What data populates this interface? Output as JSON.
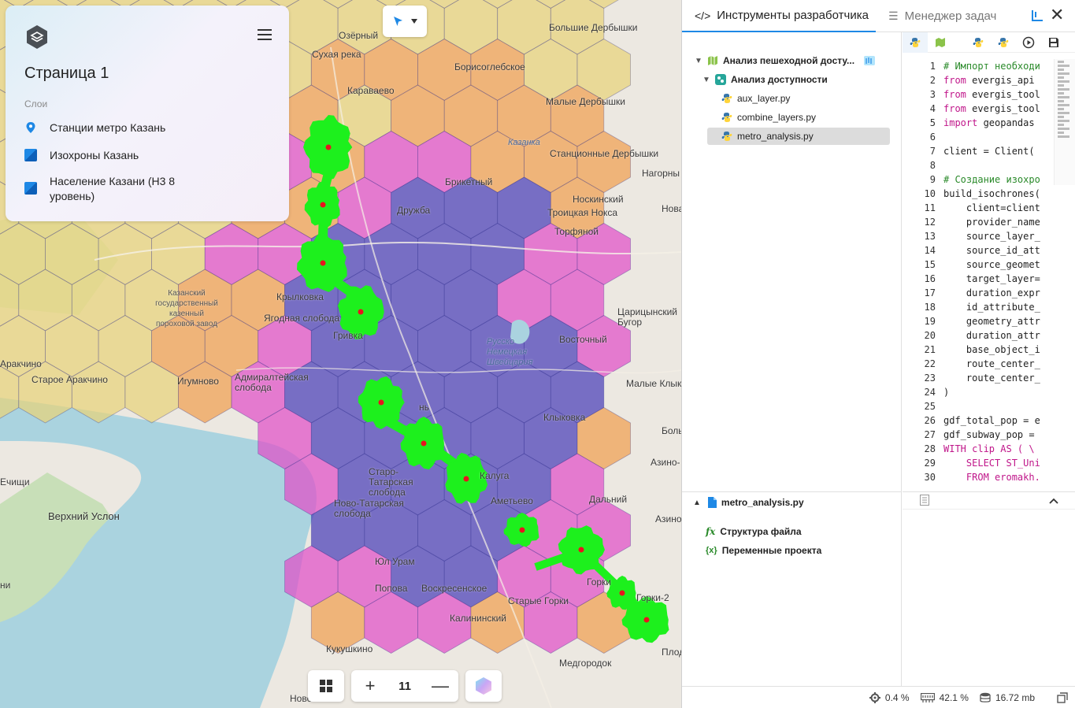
{
  "map": {
    "labels": [
      {
        "text": "Озёрный",
        "kind": "normal"
      },
      {
        "text": "Сухая река",
        "kind": "normal"
      },
      {
        "text": "Борисоглебское",
        "kind": "normal"
      },
      {
        "text": "Большие Дербышки",
        "kind": "normal"
      },
      {
        "text": "Караваево",
        "kind": "normal"
      },
      {
        "text": "Малые Дербышки",
        "kind": "normal"
      },
      {
        "text": "Казанка",
        "kind": "italic"
      },
      {
        "text": "Станционные Дербышки",
        "kind": "normal"
      },
      {
        "text": "Брикетный",
        "kind": "normal"
      },
      {
        "text": "Нагорны",
        "kind": "normal"
      },
      {
        "text": "Дружба",
        "kind": "normal"
      },
      {
        "text": "Носкинский",
        "kind": "normal"
      },
      {
        "text": "Троицкая Нокса",
        "kind": "normal"
      },
      {
        "text": "Нова",
        "kind": "normal"
      },
      {
        "text": "Торфяной",
        "kind": "normal"
      },
      {
        "text": "Казанский государственный казенный пороховой завод",
        "kind": "small"
      },
      {
        "text": "Крылковка",
        "kind": "normal"
      },
      {
        "text": "Ягодная слобода",
        "kind": "normal"
      },
      {
        "text": "Царицынский Бугор",
        "kind": "normal"
      },
      {
        "text": "Гривка",
        "kind": "normal"
      },
      {
        "text": "Русско Немецкая Швейцария",
        "kind": "italic"
      },
      {
        "text": "Восточный",
        "kind": "normal"
      },
      {
        "text": "Аракчино",
        "kind": "normal"
      },
      {
        "text": "Старое Аракчино",
        "kind": "normal"
      },
      {
        "text": "Иrумново",
        "kind": "normal"
      },
      {
        "text": "Адмиралтейская слобода",
        "kind": "normal"
      },
      {
        "text": "Малые Клык",
        "kind": "normal"
      },
      {
        "text": "Клыковка",
        "kind": "normal"
      },
      {
        "text": "Боль",
        "kind": "normal"
      },
      {
        "text": "Азино-",
        "kind": "normal"
      },
      {
        "text": "Старо-Татарская слобода",
        "kind": "normal"
      },
      {
        "text": "Калуга",
        "kind": "normal"
      },
      {
        "text": "Ечищи",
        "kind": "normal"
      },
      {
        "text": "Верхний Услон",
        "kind": "big"
      },
      {
        "text": "Ново-Татарская слобода",
        "kind": "normal"
      },
      {
        "text": "Аметьево",
        "kind": "normal"
      },
      {
        "text": "Дальний",
        "kind": "normal"
      },
      {
        "text": "Азино",
        "kind": "normal"
      },
      {
        "text": "Юл Урам",
        "kind": "normal"
      },
      {
        "text": "Горки",
        "kind": "normal"
      },
      {
        "text": "Попова",
        "kind": "normal"
      },
      {
        "text": "Воскресенское",
        "kind": "normal"
      },
      {
        "text": "Старые Горки",
        "kind": "normal"
      },
      {
        "text": "Горки-2",
        "kind": "normal"
      },
      {
        "text": "Калининский",
        "kind": "normal"
      },
      {
        "text": "Кукушкино",
        "kind": "normal"
      },
      {
        "text": "Медгородок",
        "kind": "normal"
      },
      {
        "text": "Плод",
        "kind": "normal"
      },
      {
        "text": "Ново",
        "kind": "normal"
      },
      {
        "text": "ни",
        "kind": "normal"
      },
      {
        "text": "нь",
        "kind": "normal"
      }
    ],
    "colors": {
      "water": "#aad3df",
      "hex_blue": "#4a3fb8",
      "hex_magenta": "#e04fc8",
      "hex_orange": "#f0a050",
      "hex_yellow": "#e8d27a",
      "isochrone": "#1df01d",
      "station": "#e8141e"
    }
  },
  "layers_panel": {
    "page_title": "Страница 1",
    "heading": "Слои",
    "layers": [
      {
        "label": "Станции метро Казань",
        "icon": "map-pin-icon"
      },
      {
        "label": "Изохроны Казань",
        "icon": "polygon-layer-icon"
      },
      {
        "label": "Население Казани (Н3 8 уровень)",
        "icon": "polygon-layer-icon"
      }
    ]
  },
  "zoom": {
    "value": "11",
    "plus": "+",
    "minus": "—"
  },
  "devtools": {
    "tabs": [
      {
        "label": "Инструменты разработчика",
        "icon": "code-icon",
        "active": true
      },
      {
        "label": "Менеджер задач",
        "icon": "list-icon",
        "active": false
      }
    ],
    "tree": [
      {
        "label": "Анализ пешеходной досту...",
        "level": 0,
        "icon": "map-icon",
        "bold": true
      },
      {
        "label": "Анализ доступности",
        "level": 1,
        "icon": "notebook-icon",
        "bold": true
      },
      {
        "label": "aux_layer.py",
        "level": 2,
        "icon": "python-icon"
      },
      {
        "label": "combine_layers.py",
        "level": 2,
        "icon": "python-icon"
      },
      {
        "label": "metro_analysis.py",
        "level": 2,
        "icon": "python-icon",
        "selected": true
      }
    ],
    "code": [
      {
        "n": "1",
        "segs": [
          {
            "t": "# Импорт необходи",
            "c": "cm"
          }
        ]
      },
      {
        "n": "2",
        "segs": [
          {
            "t": "from",
            "c": "kw"
          },
          {
            "t": " evergis_api",
            "c": "ct"
          }
        ]
      },
      {
        "n": "3",
        "segs": [
          {
            "t": "from",
            "c": "kw"
          },
          {
            "t": " evergis_tool",
            "c": "ct"
          }
        ]
      },
      {
        "n": "4",
        "segs": [
          {
            "t": "from",
            "c": "kw"
          },
          {
            "t": " evergis_tool",
            "c": "ct"
          }
        ]
      },
      {
        "n": "5",
        "segs": [
          {
            "t": "import",
            "c": "kw"
          },
          {
            "t": " geopandas",
            "c": "ct"
          }
        ]
      },
      {
        "n": "6",
        "segs": []
      },
      {
        "n": "7",
        "segs": [
          {
            "t": "client = Client(",
            "c": "ct"
          }
        ]
      },
      {
        "n": "8",
        "segs": []
      },
      {
        "n": "9",
        "segs": [
          {
            "t": "# Создание изохро",
            "c": "cm"
          }
        ]
      },
      {
        "n": "10",
        "segs": [
          {
            "t": "build_isochrones(",
            "c": "ct"
          }
        ]
      },
      {
        "n": "11",
        "segs": [
          {
            "t": "    client=client",
            "c": "ct"
          }
        ]
      },
      {
        "n": "12",
        "segs": [
          {
            "t": "    provider_name",
            "c": "ct"
          }
        ]
      },
      {
        "n": "13",
        "segs": [
          {
            "t": "    source_layer_",
            "c": "ct"
          }
        ]
      },
      {
        "n": "14",
        "segs": [
          {
            "t": "    source_id_att",
            "c": "ct"
          }
        ]
      },
      {
        "n": "15",
        "segs": [
          {
            "t": "    source_geomet",
            "c": "ct"
          }
        ]
      },
      {
        "n": "16",
        "segs": [
          {
            "t": "    target_layer=",
            "c": "ct"
          }
        ]
      },
      {
        "n": "17",
        "segs": [
          {
            "t": "    duration_expr",
            "c": "ct"
          }
        ]
      },
      {
        "n": "18",
        "segs": [
          {
            "t": "    id_attribute_",
            "c": "ct"
          }
        ]
      },
      {
        "n": "19",
        "segs": [
          {
            "t": "    geometry_attr",
            "c": "ct"
          }
        ]
      },
      {
        "n": "20",
        "segs": [
          {
            "t": "    duration_attr",
            "c": "ct"
          }
        ]
      },
      {
        "n": "21",
        "segs": [
          {
            "t": "    base_object_i",
            "c": "ct"
          }
        ]
      },
      {
        "n": "22",
        "segs": [
          {
            "t": "    route_center_",
            "c": "ct"
          }
        ]
      },
      {
        "n": "23",
        "segs": [
          {
            "t": "    route_center_",
            "c": "ct"
          }
        ]
      },
      {
        "n": "24",
        "segs": [
          {
            "t": ")",
            "c": "ct"
          }
        ]
      },
      {
        "n": "25",
        "segs": []
      },
      {
        "n": "26",
        "segs": [
          {
            "t": "gdf_total_pop = e",
            "c": "ct"
          }
        ]
      },
      {
        "n": "27",
        "segs": [
          {
            "t": "gdf_subway_pop = ",
            "c": "ct"
          }
        ]
      },
      {
        "n": "28",
        "segs": [
          {
            "t": "WITH clip AS ( \\",
            "c": "kw"
          }
        ]
      },
      {
        "n": "29",
        "segs": [
          {
            "t": "    SELECT ST_Uni",
            "c": "kw"
          }
        ]
      },
      {
        "n": "30",
        "segs": [
          {
            "t": "    FROM eromakh.",
            "c": "kw"
          }
        ]
      }
    ],
    "file_panel": {
      "file_name": "metro_analysis.py",
      "structure_label": "Структура файла",
      "variables_label": "Переменные проекта"
    },
    "status": {
      "cpu": "0.4 %",
      "memory": "42.1 %",
      "storage": "16.72 mb"
    }
  }
}
